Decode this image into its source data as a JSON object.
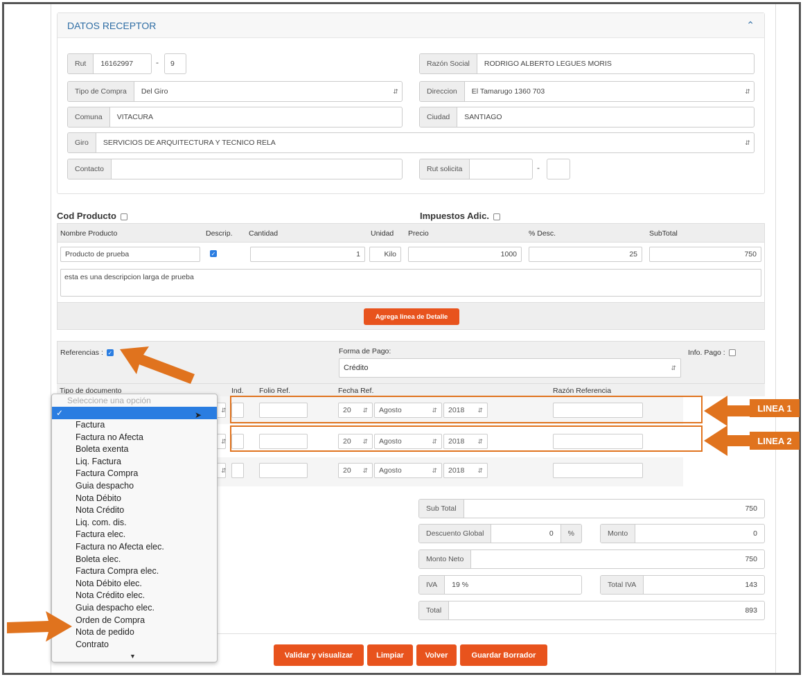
{
  "receptor": {
    "title": "DATOS RECEPTOR",
    "rut_label": "Rut",
    "rut_value": "16162997",
    "rut_dash": "-",
    "rut_dv": "9",
    "razon_label": "Razón Social",
    "razon_value": "RODRIGO ALBERTO LEGUES MORIS",
    "tipo_compra_label": "Tipo de Compra",
    "tipo_compra_value": "Del Giro",
    "direccion_label": "Direccion",
    "direccion_value": "El Tamarugo 1360 703",
    "comuna_label": "Comuna",
    "comuna_value": "VITACURA",
    "ciudad_label": "Ciudad",
    "ciudad_value": "SANTIAGO",
    "giro_label": "Giro",
    "giro_value": "SERVICIOS DE ARQUITECTURA Y TECNICO RELA",
    "contacto_label": "Contacto",
    "rut_solicita_label": "Rut solicita",
    "rut_solicita_dash": "-"
  },
  "product": {
    "cod_label": "Cod Producto",
    "impuestos_label": "Impuestos Adic.",
    "headers": [
      "Nombre Producto",
      "Descrip.",
      "Cantidad",
      "Unidad",
      "Precio",
      "% Desc.",
      "SubTotal"
    ],
    "nombre": "Producto de prueba",
    "cantidad": "1",
    "unidad": "Kilo",
    "precio": "1000",
    "desc": "25",
    "subtotal": "750",
    "descripcion": "esta es una descripcion larga de prueba",
    "add_button": "Agrega linea de Detalle"
  },
  "refs": {
    "label": "Referencias :",
    "forma_pago_label": "Forma de Pago:",
    "forma_pago_value": "Crédito",
    "info_pago_label": "Info. Pago :",
    "cols": {
      "tipo": "Tipo de documento",
      "ind": "Ind.",
      "folio": "Folio Ref.",
      "fecha": "Fecha Ref.",
      "razon": "Razón Referencia"
    },
    "day": "20",
    "month": "Agosto",
    "year": "2018"
  },
  "dropdown": {
    "placeholder": "Seleccione una opción",
    "selected_mark": "✓",
    "options": [
      "Factura",
      "Factura no Afecta",
      "Boleta exenta",
      "Liq. Factura",
      "Factura Compra",
      "Guia despacho",
      "Nota Débito",
      "Nota Crédito",
      "Liq. com. dis.",
      "Factura elec.",
      "Factura no Afecta elec.",
      "Boleta elec.",
      "Factura Compra elec.",
      "Nota Débito elec.",
      "Nota Crédito elec.",
      "Guia despacho elec.",
      "Orden de Compra",
      "Nota de pedido",
      "Contrato"
    ]
  },
  "totals": {
    "subtotal_label": "Sub Total",
    "subtotal_value": "750",
    "desc_global_label": "Descuento Global",
    "desc_global_value": "0",
    "percent": "%",
    "monto_label": "Monto",
    "monto_value": "0",
    "neto_label": "Monto Neto",
    "neto_value": "750",
    "iva_label": "IVA",
    "iva_value": "19 %",
    "total_iva_label": "Total IVA",
    "total_iva_value": "143",
    "total_label": "Total",
    "total_value": "893"
  },
  "actions": {
    "validar": "Validar y visualizar",
    "limpiar": "Limpiar",
    "volver": "Volver",
    "guardar": "Guardar Borrador"
  },
  "callouts": {
    "linea1": "LINEA 1",
    "linea2": "LINEA 2"
  },
  "colors": {
    "accent": "#e8531d",
    "annotation": "#e0731e",
    "link": "#2e6da4"
  }
}
